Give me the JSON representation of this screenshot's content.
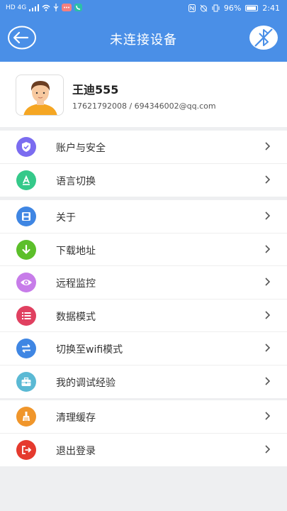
{
  "status_bar": {
    "signal": "HD 4G",
    "battery": "96%",
    "time": "2:41"
  },
  "header": {
    "title": "未连接设备",
    "back_icon": "back-arrow-circle-icon",
    "bluetooth_icon": "bluetooth-disabled-icon"
  },
  "profile": {
    "name": "王迪555",
    "contact": "17621792008 / 694346002@qq.com"
  },
  "groups": [
    {
      "items": [
        {
          "label": "账户与安全",
          "icon": "shield-check-icon",
          "color": "#7b6cf0"
        },
        {
          "label": "语言切换",
          "icon": "letter-a-icon",
          "color": "#35c98a"
        }
      ]
    },
    {
      "items": [
        {
          "label": "关于",
          "icon": "floppy-disk-icon",
          "color": "#3f86e3"
        },
        {
          "label": "下载地址",
          "icon": "download-arrow-icon",
          "color": "#5cbf2a"
        },
        {
          "label": "远程监控",
          "icon": "eye-icon",
          "color": "#c77ce9"
        },
        {
          "label": "数据模式",
          "icon": "list-icon",
          "color": "#e04060"
        },
        {
          "label": "切换至wifi模式",
          "icon": "swap-arrows-icon",
          "color": "#3f86e3"
        },
        {
          "label": "我的调试经验",
          "icon": "toolbox-icon",
          "color": "#5ab9d4"
        }
      ]
    },
    {
      "items": [
        {
          "label": "清理缓存",
          "icon": "broom-icon",
          "color": "#f0962b"
        },
        {
          "label": "退出登录",
          "icon": "logout-icon",
          "color": "#e53a2e"
        }
      ]
    }
  ]
}
